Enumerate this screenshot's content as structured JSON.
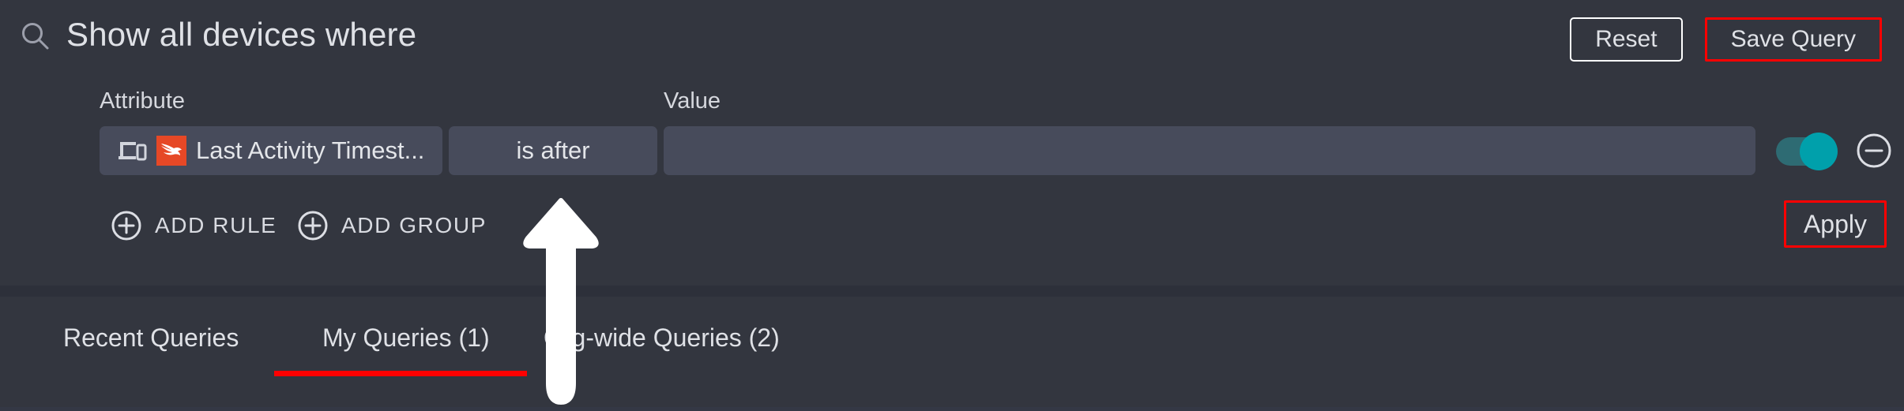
{
  "header": {
    "search_icon": "search-icon",
    "title": "Show all devices where",
    "reset_label": "Reset",
    "save_query_label": "Save Query"
  },
  "builder": {
    "labels": {
      "attribute": "Attribute",
      "value": "Value"
    },
    "rule": {
      "attribute_icon": "device-icon",
      "vendor_icon": "crowdstrike-falcon-logo",
      "attribute_value": "Last Activity Timest...",
      "operator_value": "is after",
      "value_text": "",
      "value_placeholder": "",
      "toggle_state": "on",
      "remove_icon": "minus-circle-icon"
    },
    "add_rule_label": "ADD RULE",
    "add_group_label": "ADD GROUP",
    "add_icon": "plus-circle-icon",
    "apply_label": "Apply"
  },
  "tabs": [
    {
      "label": "Recent Queries",
      "active": false
    },
    {
      "label": "My Queries (1)",
      "active": true
    },
    {
      "label": "Org-wide Queries (2)",
      "active": false
    }
  ],
  "annotation": {
    "cursor": "up-arrow-cursor"
  },
  "colors": {
    "background": "#33363f",
    "field": "#474b5b",
    "accent_red": "#ff0000",
    "vendor_red": "#e64826",
    "toggle_on": "#00a0ab",
    "text": "#dfe1e6"
  }
}
